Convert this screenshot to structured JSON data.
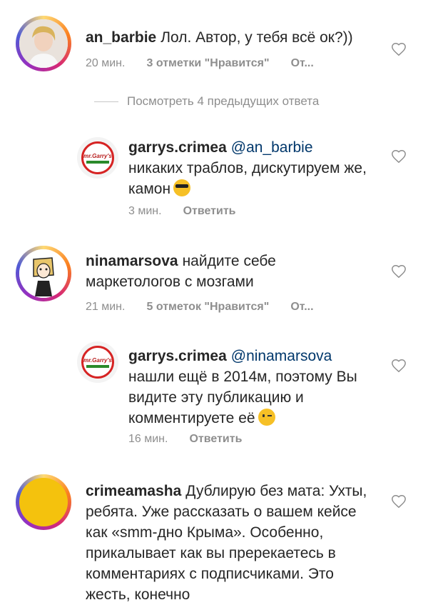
{
  "comments": [
    {
      "username": "an_barbie",
      "text": "Лол. Автор, у тебя всё ок?))",
      "time": "20 мин.",
      "likes": "3 отметки \"Нравится\"",
      "action": "От..."
    },
    {
      "username": "garrys.crimea",
      "mention": "@an_barbie",
      "text": "никаких траблов, дискутируем же, камон",
      "time": "3 мин.",
      "action": "Ответить",
      "avatar_text": "mr.Garry's"
    },
    {
      "username": "ninamarsova",
      "text": "найдите себе маркетологов с мозгами",
      "time": "21 мин.",
      "likes": "5 отметок \"Нравится\"",
      "action": "От..."
    },
    {
      "username": "garrys.crimea",
      "mention": "@ninamarsova",
      "text": "нашли ещё в 2014м, поэтому Вы видите эту публикацию и комментируете её",
      "time": "16 мин.",
      "action": "Ответить",
      "avatar_text": "mr.Garry's"
    },
    {
      "username": "crimeamasha",
      "text": "Дублирую без мата: Ухты, ребята.  Уже рассказать о вашем кейсе как «smm-дно Крыма». Особенно, прикалывает как вы пререкаетесь в комментариях с подписчиками. Это жесть, конечно"
    }
  ],
  "view_replies": "Посмотреть 4 предыдущих ответа",
  "icons": {
    "heart": "heart-icon",
    "emoji_cool": "sunglasses-emoji-icon",
    "emoji_wink": "wink-emoji-icon"
  },
  "colors": {
    "text": "#262626",
    "meta": "#8e8e8e",
    "mention": "#00376b",
    "story_ring": "#d62976"
  }
}
